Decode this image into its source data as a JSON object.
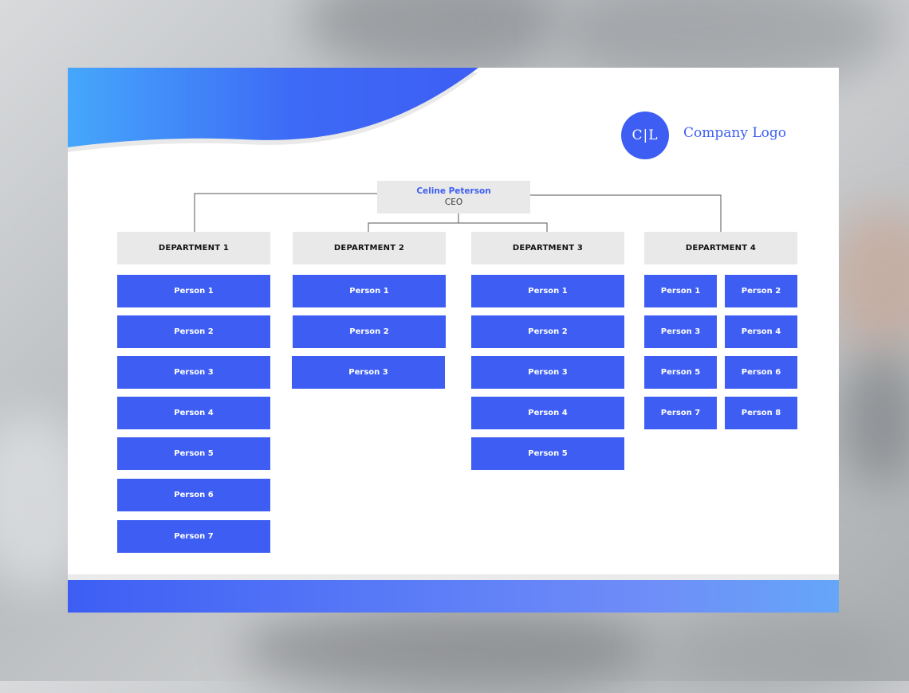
{
  "logo": {
    "initials": "C|L",
    "text": "Company Logo"
  },
  "ceo": {
    "name": "Celine Peterson",
    "title": "CEO"
  },
  "departments": [
    {
      "label": "DEPARTMENT 1",
      "people": [
        "Person 1",
        "Person 2",
        "Person 3",
        "Person 4",
        "Person 5",
        "Person 6",
        "Person 7"
      ]
    },
    {
      "label": "DEPARTMENT 2",
      "people": [
        "Person 1",
        "Person 2",
        "Person 3"
      ]
    },
    {
      "label": "DEPARTMENT 3",
      "people": [
        "Person 1",
        "Person 2",
        "Person 3",
        "Person 4",
        "Person 5"
      ]
    },
    {
      "label": "DEPARTMENT 4",
      "people": [
        "Person 1",
        "Person 2",
        "Person 3",
        "Person 4",
        "Person 5",
        "Person 6",
        "Person 7",
        "Person 8"
      ]
    }
  ],
  "colors": {
    "accent": "#3e5ef3",
    "box_gray": "#e9e9e9",
    "gradient_light": "#45a7fb"
  }
}
